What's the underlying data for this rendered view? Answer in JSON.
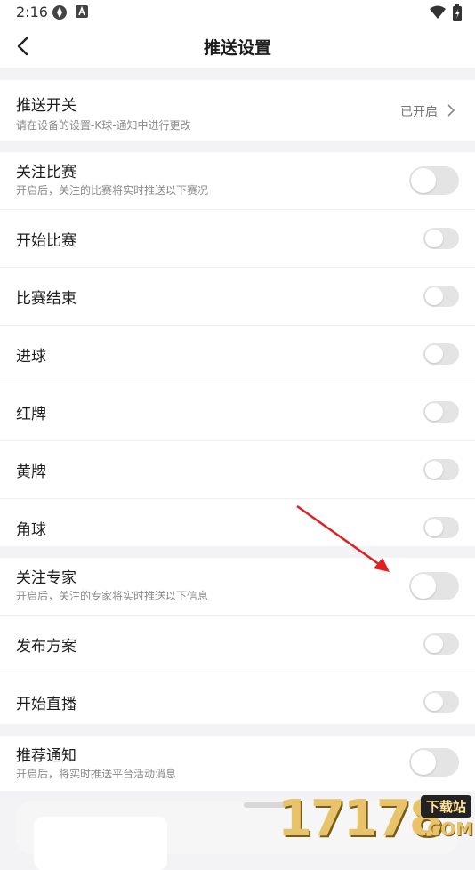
{
  "status_bar": {
    "time": "2:16"
  },
  "header": {
    "title": "推送设置"
  },
  "push_switch": {
    "label": "推送开关",
    "sub": "请在设备的设置-K球-通知中进行更改",
    "status": "已开启"
  },
  "match_section": {
    "follow": {
      "label": "关注比赛",
      "sub": "开启后，关注的比赛将实时推送以下赛况",
      "enabled": false
    },
    "items": [
      {
        "label": "开始比赛",
        "enabled": false
      },
      {
        "label": "比赛结束",
        "enabled": false
      },
      {
        "label": "进球",
        "enabled": false
      },
      {
        "label": "红牌",
        "enabled": false
      },
      {
        "label": "黄牌",
        "enabled": false
      },
      {
        "label": "角球",
        "enabled": false
      }
    ]
  },
  "expert_section": {
    "follow": {
      "label": "关注专家",
      "sub": "开启后，关注的专家将实时推送以下信息",
      "enabled": false
    },
    "items": [
      {
        "label": "发布方案",
        "enabled": false
      },
      {
        "label": "开始直播",
        "enabled": false
      }
    ]
  },
  "recommend_section": {
    "label": "推荐通知",
    "sub": "开启后，将实时推送平台活动消息",
    "enabled": false
  },
  "watermark": {
    "numbers": "17178",
    "badge": "下载站",
    "suffix": ".COM"
  },
  "colors": {
    "toggle_off": "#e4e4e4",
    "arrow": "#e02020",
    "watermark": "#e7c36b"
  }
}
